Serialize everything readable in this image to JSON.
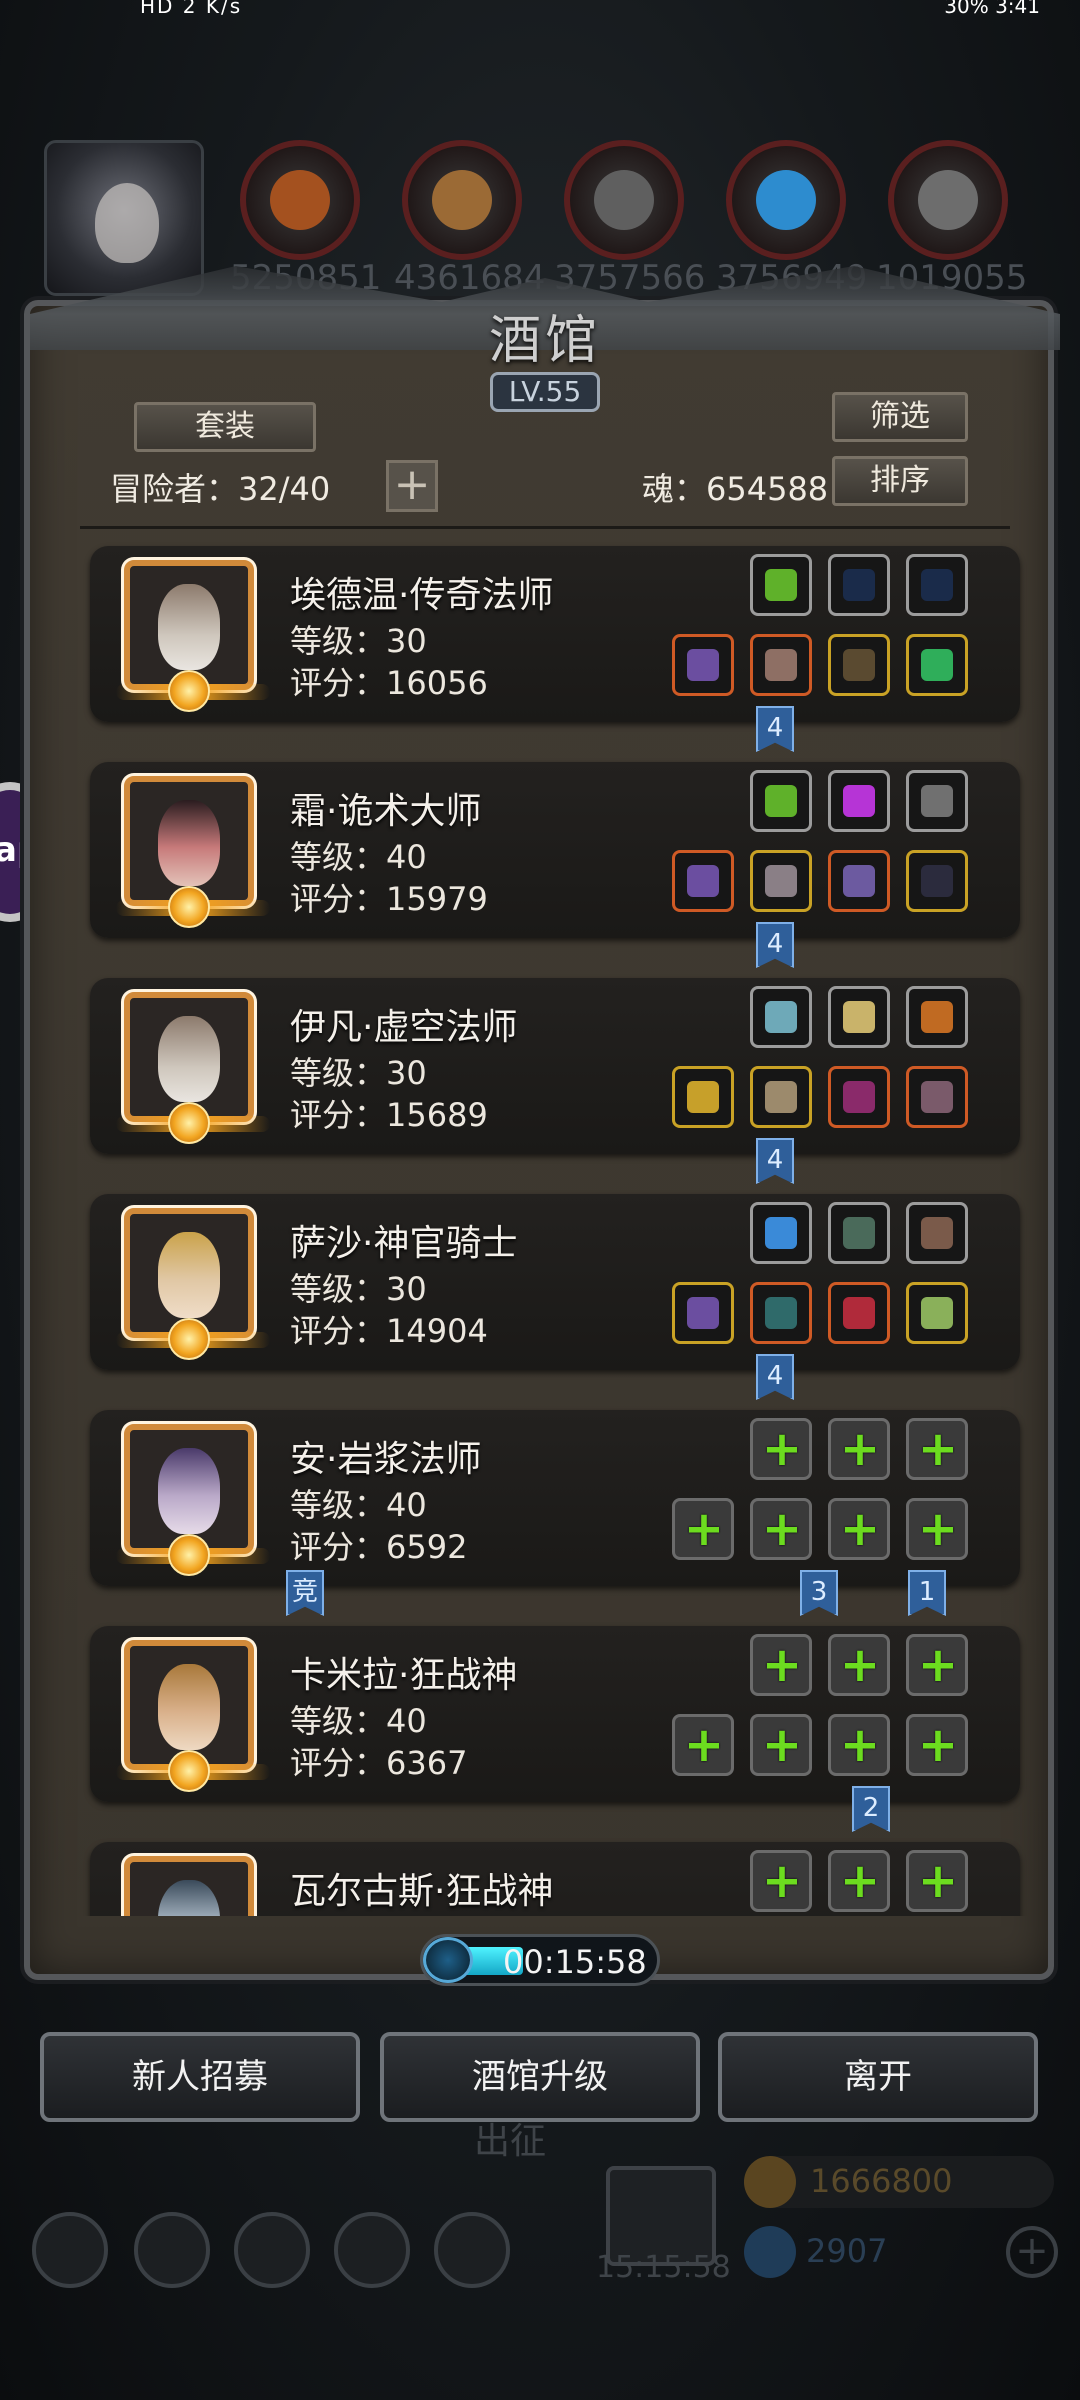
{
  "status_bar": {
    "left": "HD 2  K/s",
    "right": "30%  3:41"
  },
  "resources": {
    "values": [
      "5250851",
      "4361684",
      "3757566",
      "3756949",
      "1019055"
    ]
  },
  "panel": {
    "title": "酒馆",
    "level": "LV.55",
    "set_button": "套装",
    "filter_button": "筛选",
    "sort_button": "排序",
    "adventurers_label": "冒险者：32/40",
    "add_symbol": "+",
    "soul_label": "魂：654588"
  },
  "heroes": [
    {
      "name": "埃德温·传奇法师",
      "level": "等级：30",
      "score": "评分：16056",
      "flags": [
        "4"
      ]
    },
    {
      "name": "霜·诡术大师",
      "level": "等级：40",
      "score": "评分：15979",
      "flags": [
        "4"
      ]
    },
    {
      "name": "伊凡·虚空法师",
      "level": "等级：30",
      "score": "评分：15689",
      "flags": [
        "4"
      ]
    },
    {
      "name": "萨沙·神官骑士",
      "level": "等级：30",
      "score": "评分：14904",
      "flags": [
        "4"
      ]
    },
    {
      "name": "安·岩浆法师",
      "level": "等级：40",
      "score": "评分：6592",
      "flags": [
        "竞",
        "3",
        "1"
      ]
    },
    {
      "name": "卡米拉·狂战神",
      "level": "等级：40",
      "score": "评分：6367",
      "flags": [
        "2"
      ]
    },
    {
      "name": "瓦尔古斯·狂战神",
      "level": "",
      "score": "",
      "flags": []
    }
  ],
  "timer": {
    "value": "00:15:58"
  },
  "buttons": {
    "recruit": "新人招募",
    "upgrade": "酒馆升级",
    "leave": "离开"
  },
  "background": {
    "expedition": "出征",
    "gift_timer": "15:15:58",
    "gold": "1666800",
    "gems": "2907"
  },
  "side_badge": "ap",
  "colors": {
    "panel": "#3d382f",
    "accent_green": "#6cdc1f",
    "portrait_border": "#d18a3a",
    "flag_blue": "#2f5f9a"
  }
}
